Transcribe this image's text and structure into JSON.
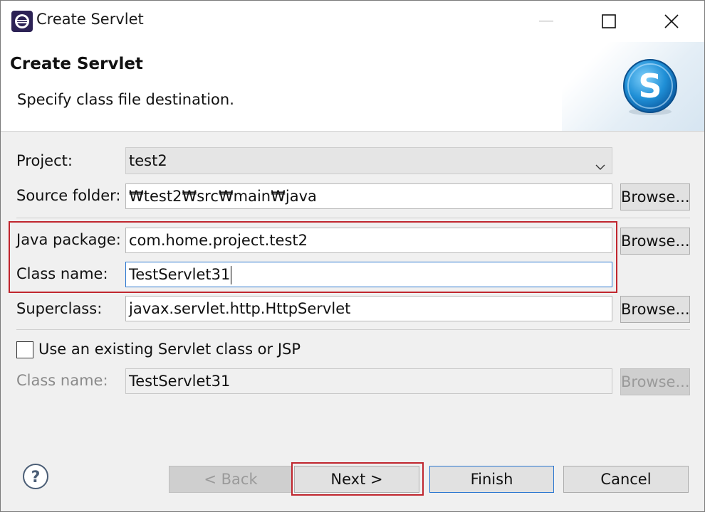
{
  "window": {
    "title": "Create Servlet",
    "app_icon": "eclipse-icon"
  },
  "header": {
    "title": "Create Servlet",
    "subtitle": "Specify class file destination.",
    "logo_icon": "servlet-s-logo-icon"
  },
  "form": {
    "project_label": "Project:",
    "project_value": "test2",
    "source_folder_label": "Source folder:",
    "source_folder_value": "₩test2₩src₩main₩java",
    "java_package_label": "Java package:",
    "java_package_value": "com.home.project.test2",
    "class_name_label": "Class name:",
    "class_name_value": "TestServlet31",
    "superclass_label": "Superclass:",
    "superclass_value": "javax.servlet.http.HttpServlet",
    "existing_checkbox_label": "Use an existing Servlet class or JSP",
    "existing_checked": false,
    "existing_class_label": "Class name:",
    "existing_class_value": "TestServlet31",
    "browse_label": "Browse..."
  },
  "footer": {
    "back_label": "< Back",
    "next_label": "Next >",
    "finish_label": "Finish",
    "cancel_label": "Cancel",
    "help_icon": "help-icon"
  },
  "colors": {
    "highlight": "#c0262e",
    "focus": "#2b77d0",
    "logo": "#1f8fd6"
  }
}
